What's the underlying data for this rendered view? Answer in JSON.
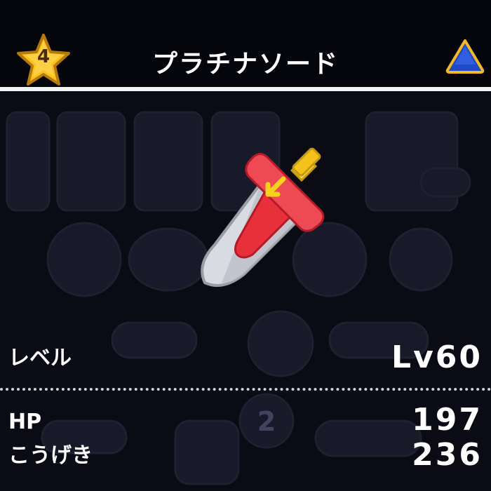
{
  "header": {
    "rarity": "4",
    "title": "プラチナソード",
    "element_icon": "blue-triangle-icon"
  },
  "stats": {
    "level_label": "レベル",
    "level_value": "Lv60",
    "hp_label": "HP",
    "hp_value": "197",
    "attack_label": "こうげき",
    "attack_value": "236"
  },
  "background": {
    "watermark_number": "2"
  },
  "colors": {
    "header_bg": "#05050c",
    "screen_bg": "#0b0b16",
    "star_gold": "#f7c21c",
    "element_blue": "#1f49c7",
    "sword_red": "#e8303b",
    "sword_silver": "#d8dbe2"
  }
}
